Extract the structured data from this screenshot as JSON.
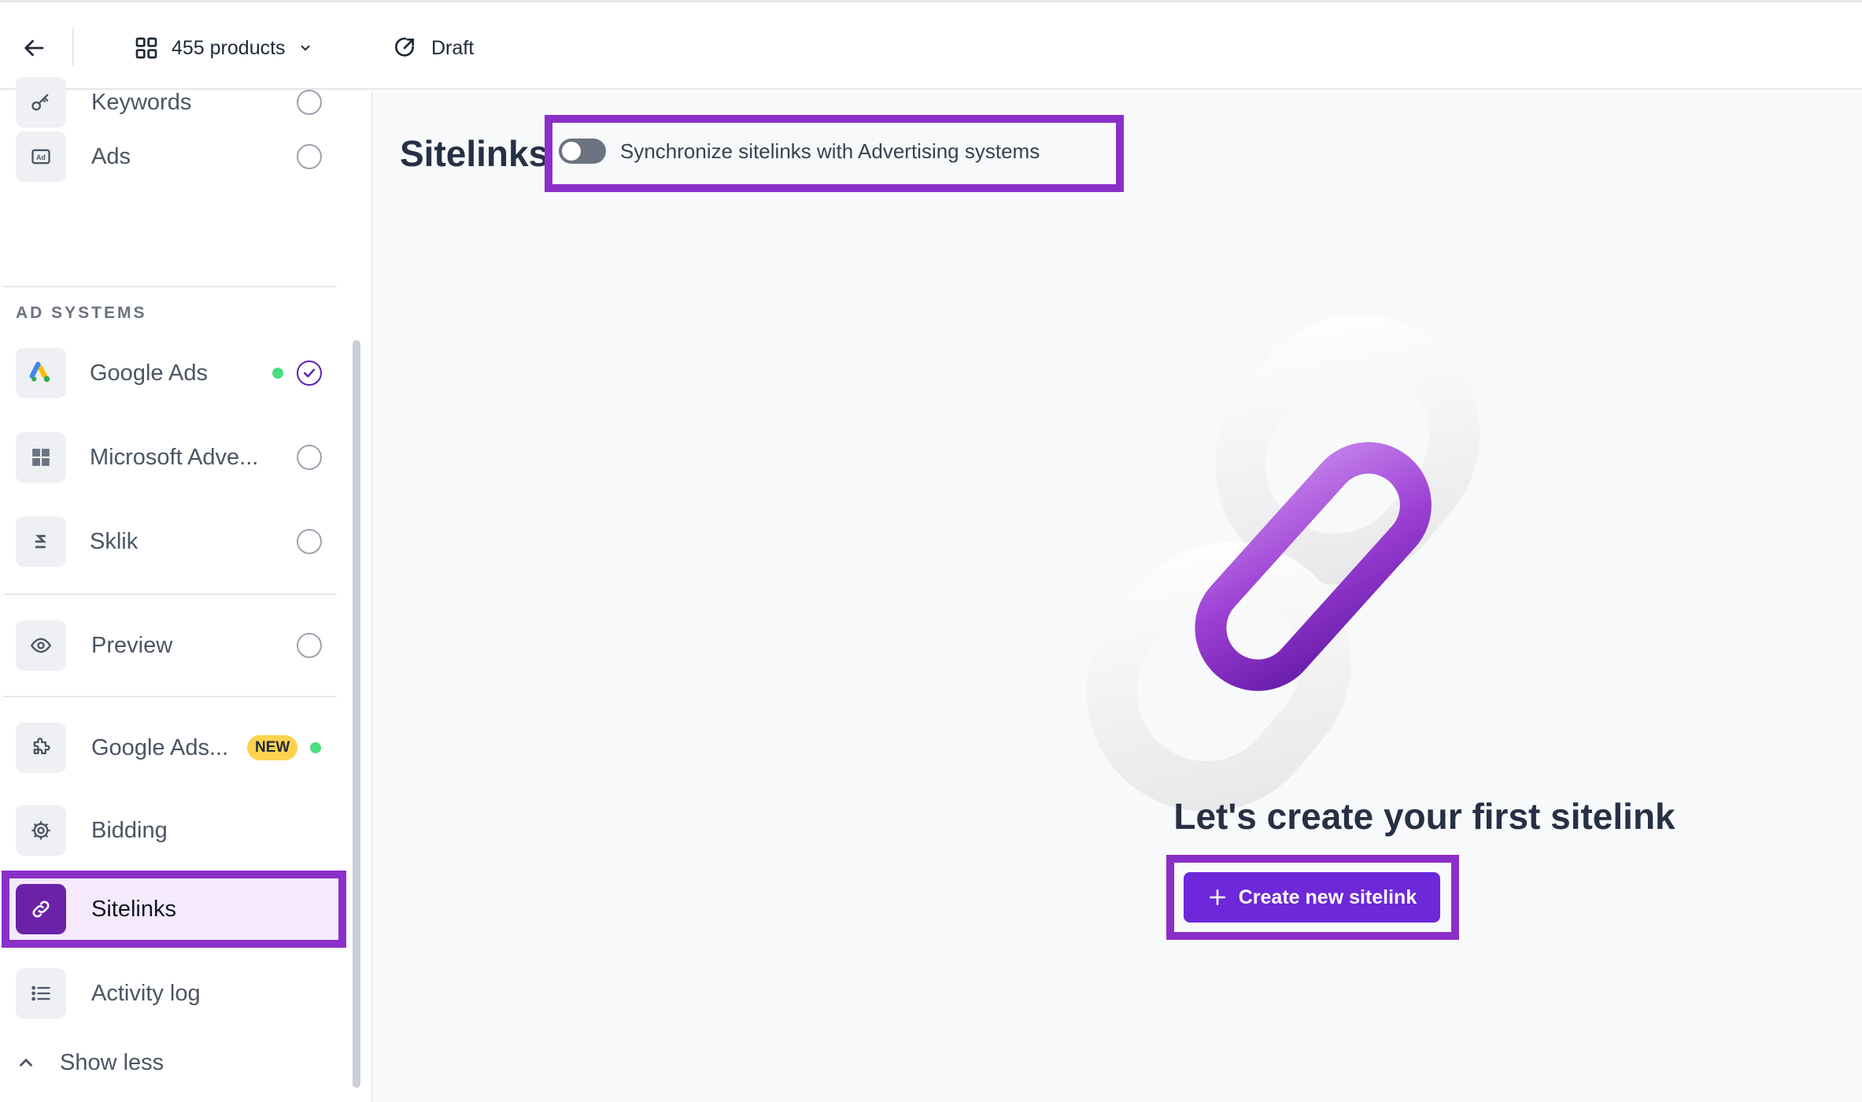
{
  "topbar": {
    "products_label": "455 products",
    "status_label": "Draft"
  },
  "sidebar": {
    "items_top": [
      {
        "label": "Keywords",
        "icon": "key-icon"
      },
      {
        "label": "Ads",
        "icon": "ad-icon"
      }
    ],
    "section_label": "AD SYSTEMS",
    "ad_systems": [
      {
        "label": "Google Ads",
        "icon": "google-ads-logo-icon",
        "active": true,
        "checked": true
      },
      {
        "label": "Microsoft Adve...",
        "icon": "microsoft-logo-icon",
        "checked": false
      },
      {
        "label": "Sklik",
        "icon": "sklik-logo-icon",
        "checked": false
      }
    ],
    "preview_label": "Preview",
    "google_ads_extra_label": "Google Ads...",
    "new_badge": "NEW",
    "bidding_label": "Bidding",
    "sitelinks_label": "Sitelinks",
    "activity_log_label": "Activity log",
    "show_less_label": "Show less"
  },
  "main": {
    "title": "Sitelinks",
    "sync_toggle_label": "Synchronize sitelinks with Advertising systems",
    "sync_enabled": false,
    "empty_title": "Let's create your first sitelink",
    "create_button_label": "Create new sitelink"
  },
  "colors": {
    "accent": "#6d28d9",
    "highlight": "#8b2fc9",
    "active_bg": "#f5eafb",
    "status_green": "#4ade80",
    "badge_yellow": "#fcd34d"
  }
}
